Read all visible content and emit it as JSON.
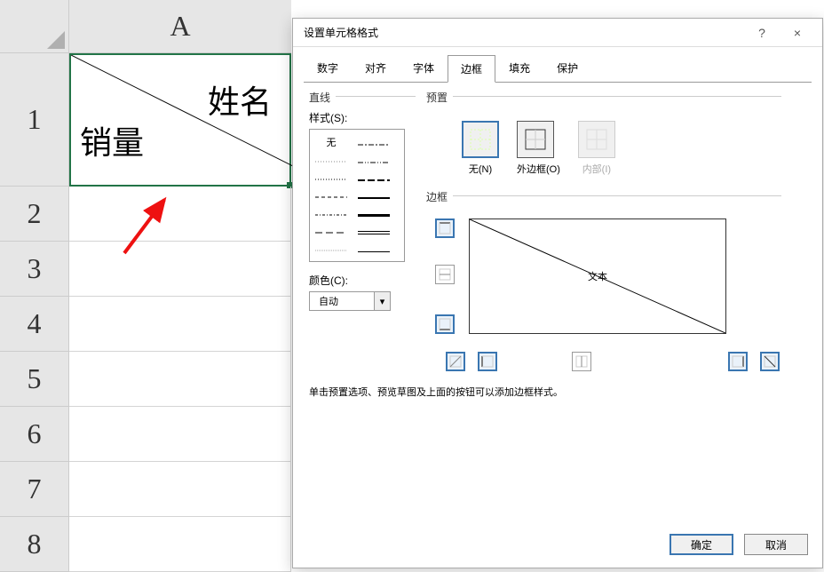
{
  "sheet": {
    "col_label": "A",
    "row_labels": [
      "1",
      "2",
      "3",
      "4",
      "5",
      "6",
      "7",
      "8"
    ],
    "cell": {
      "top_right": "姓名",
      "bottom_left": "销量"
    }
  },
  "dialog": {
    "title": "设置单元格格式",
    "help": "?",
    "close": "×",
    "tabs": [
      "数字",
      "对齐",
      "字体",
      "边框",
      "填充",
      "保护"
    ],
    "active_tab": 3,
    "line": {
      "group_label": "直线",
      "style_label": "样式(S):",
      "none_label": "无",
      "color_label": "颜色(C):",
      "color_value": "自动"
    },
    "preset": {
      "group_label": "预置",
      "items": [
        {
          "label": "无(N)",
          "key": "N"
        },
        {
          "label": "外边框(O)",
          "key": "O"
        },
        {
          "label": "内部(I)",
          "key": "I"
        }
      ]
    },
    "border": {
      "group_label": "边框",
      "preview_text": "文本"
    },
    "hint": "单击预置选项、预览草图及上面的按钮可以添加边框样式。",
    "ok": "确定",
    "cancel": "取消"
  }
}
